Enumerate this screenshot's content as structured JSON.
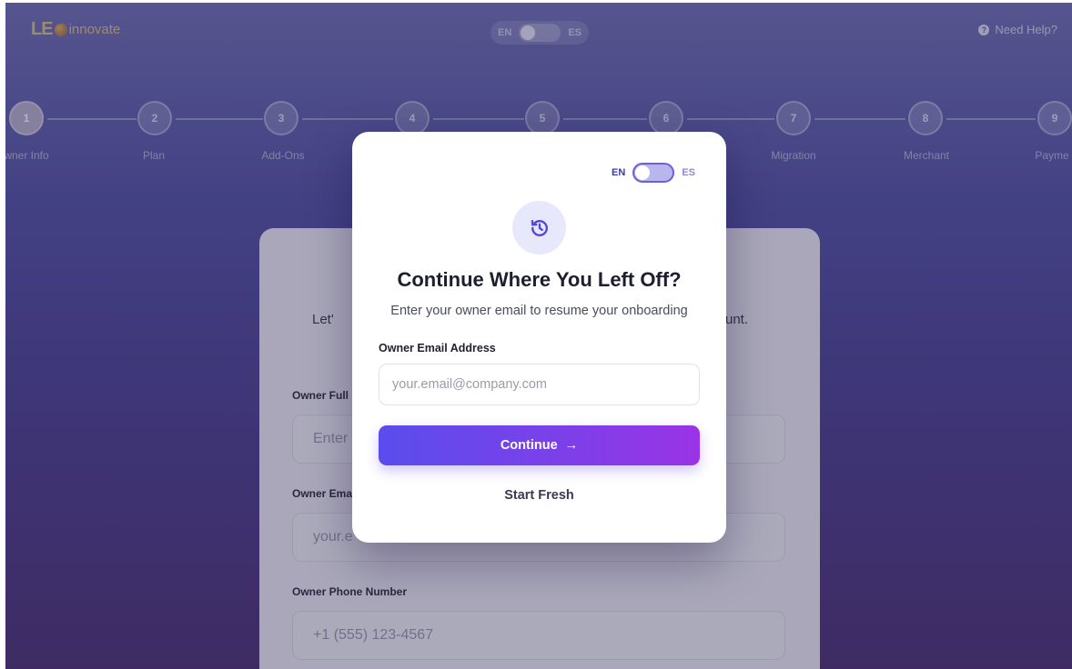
{
  "header": {
    "logo_le": "LE",
    "logo_word": "innovate",
    "lang_en": "EN",
    "lang_es": "ES",
    "help_icon": "question-circle-icon",
    "help_label": "Need Help?"
  },
  "stepper": {
    "steps": [
      {
        "num": "1",
        "label": "wner Info"
      },
      {
        "num": "2",
        "label": "Plan"
      },
      {
        "num": "3",
        "label": "Add-Ons"
      },
      {
        "num": "4",
        "label": ""
      },
      {
        "num": "5",
        "label": ""
      },
      {
        "num": "6",
        "label": ""
      },
      {
        "num": "7",
        "label": "Migration"
      },
      {
        "num": "8",
        "label": "Merchant"
      },
      {
        "num": "9",
        "label": "Payme"
      }
    ]
  },
  "form": {
    "intro_left": "Let'",
    "intro_right": "unt.",
    "full_name_label": "Owner Full",
    "full_name_placeholder": "Enter",
    "email_label": "Owner Ema",
    "email_placeholder": "your.e",
    "phone_label": "Owner Phone Number",
    "phone_placeholder": "+1 (555) 123-4567"
  },
  "modal": {
    "lang_en": "EN",
    "lang_es": "ES",
    "icon": "history-icon",
    "title": "Continue Where You Left Off?",
    "subtitle": "Enter your owner email to resume your onboarding",
    "email_label": "Owner Email Address",
    "email_placeholder": "your.email@company.com",
    "continue_label": "Continue",
    "continue_arrow": "→",
    "start_fresh_label": "Start Fresh"
  },
  "colors": {
    "accent_start": "#5a4ded",
    "accent_end": "#9a34e6",
    "background": "#4a3f8c"
  }
}
